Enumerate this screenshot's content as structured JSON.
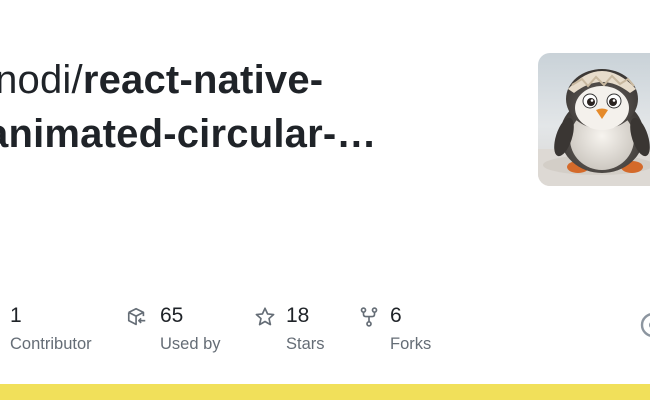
{
  "repo": {
    "owner": "inodi/",
    "name_line1": "react-native-",
    "name_line2": "animated-circular-…"
  },
  "avatar": {
    "icon": "penguin-avatar-icon"
  },
  "stats": [
    {
      "value": "1",
      "label": "Contributor",
      "icon": "people-icon"
    },
    {
      "value": "65",
      "label": "Used by",
      "icon": "package-dependents-icon"
    },
    {
      "value": "18",
      "label": "Stars",
      "icon": "star-icon"
    },
    {
      "value": "6",
      "label": "Forks",
      "icon": "fork-icon"
    }
  ],
  "colors": {
    "accent_bar": "#f1e05a",
    "text_primary": "#1f2328",
    "text_secondary": "#656d76"
  }
}
